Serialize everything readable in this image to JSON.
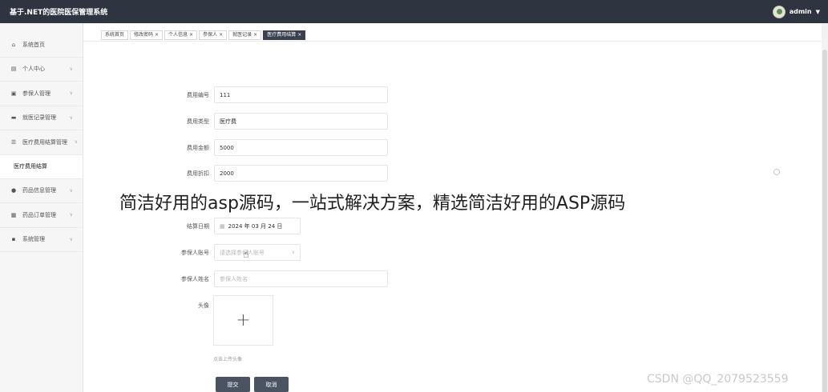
{
  "header": {
    "title": "基于.NET的医院医保管理系统",
    "username": "admin",
    "caret": "▼"
  },
  "sidebar": {
    "items": [
      {
        "label": "系统首页",
        "icon": "home-icon",
        "glyph": "⌂",
        "has_arrow": false
      },
      {
        "label": "个人中心",
        "icon": "profile-icon",
        "glyph": "▤",
        "has_arrow": true
      },
      {
        "label": "参保人管理",
        "icon": "clipboard-icon",
        "glyph": "▣",
        "has_arrow": true
      },
      {
        "label": "就医记录管理",
        "icon": "bed-icon",
        "glyph": "▬",
        "has_arrow": true
      },
      {
        "label": "医疗费用结算管理",
        "icon": "sliders-icon",
        "glyph": "☰",
        "has_arrow": true
      },
      {
        "label": "药品信息管理",
        "icon": "user-icon",
        "glyph": "●",
        "has_arrow": true
      },
      {
        "label": "药品订单管理",
        "icon": "calendar-icon",
        "glyph": "▦",
        "has_arrow": true
      },
      {
        "label": "系统管理",
        "icon": "grid-icon",
        "glyph": "▪",
        "has_arrow": true
      }
    ],
    "active_sub": "医疗费用结算",
    "arrow": "∨"
  },
  "tabs": [
    {
      "label": "系统首页",
      "closable": false,
      "active": false
    },
    {
      "label": "修改密码",
      "closable": true,
      "active": false
    },
    {
      "label": "个人信息",
      "closable": true,
      "active": false
    },
    {
      "label": "参保人",
      "closable": true,
      "active": false
    },
    {
      "label": "就医记录",
      "closable": true,
      "active": false
    },
    {
      "label": "医疗费用结算",
      "closable": true,
      "active": true
    }
  ],
  "form": {
    "fee_no_label": "费用编号",
    "fee_no_value": "111",
    "fee_type_label": "费用类型",
    "fee_type_value": "医疗费",
    "fee_amount_label": "费用金额",
    "fee_amount_value": "5000",
    "fee_discount_label": "费用折扣",
    "fee_discount_value": "2000",
    "settle_date_label": "结算日期",
    "settle_date_value": "2024 年 03 月 24 日",
    "insured_account_label": "参保人账号",
    "insured_account_placeholder": "请选择参保人账号",
    "insured_name_label": "参保人姓名",
    "insured_name_placeholder": "参保人姓名",
    "avatar_label": "头像",
    "upload_plus": "+",
    "upload_hint": "点击上传头像",
    "submit_label": "提交",
    "cancel_label": "取消"
  },
  "overlay": {
    "banner": "简洁好用的asp源码，一站式解决方案，精选简洁好用的ASP源码",
    "watermark": "CSDN @QQ_2079523559"
  }
}
